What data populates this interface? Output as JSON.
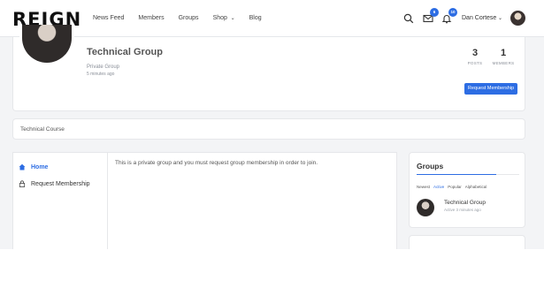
{
  "header": {
    "logo": "REIGN",
    "nav": [
      {
        "label": "News Feed",
        "dropdown": false
      },
      {
        "label": "Members",
        "dropdown": false
      },
      {
        "label": "Groups",
        "dropdown": false
      },
      {
        "label": "Shop",
        "dropdown": true
      },
      {
        "label": "Blog",
        "dropdown": false
      }
    ],
    "messages_badge": "6",
    "notifications_badge": "10",
    "username": "Dan Cortese",
    "accent_color": "#2d6de3"
  },
  "group": {
    "name": "Technical Group",
    "type": "Private Group",
    "active": "5 minutes ago",
    "posts_count": "3",
    "posts_label": "POSTS",
    "members_count": "1",
    "members_label": "MEMBERS",
    "request_button": "Request Membership"
  },
  "description": "Technical Course",
  "menu": {
    "items": [
      {
        "label": "Home",
        "icon": "home-icon",
        "active": true
      },
      {
        "label": "Request Membership",
        "icon": "lock-icon",
        "active": false
      }
    ]
  },
  "main": {
    "message": "This is a private group and you must request group membership in order to join."
  },
  "widget": {
    "title": "Groups",
    "filters": [
      "Newest",
      "Active",
      "Popular",
      "Alphabetical"
    ],
    "active_filter": "Active",
    "item": {
      "name": "Technical Group",
      "meta": "Active 3 minutes ago"
    }
  }
}
